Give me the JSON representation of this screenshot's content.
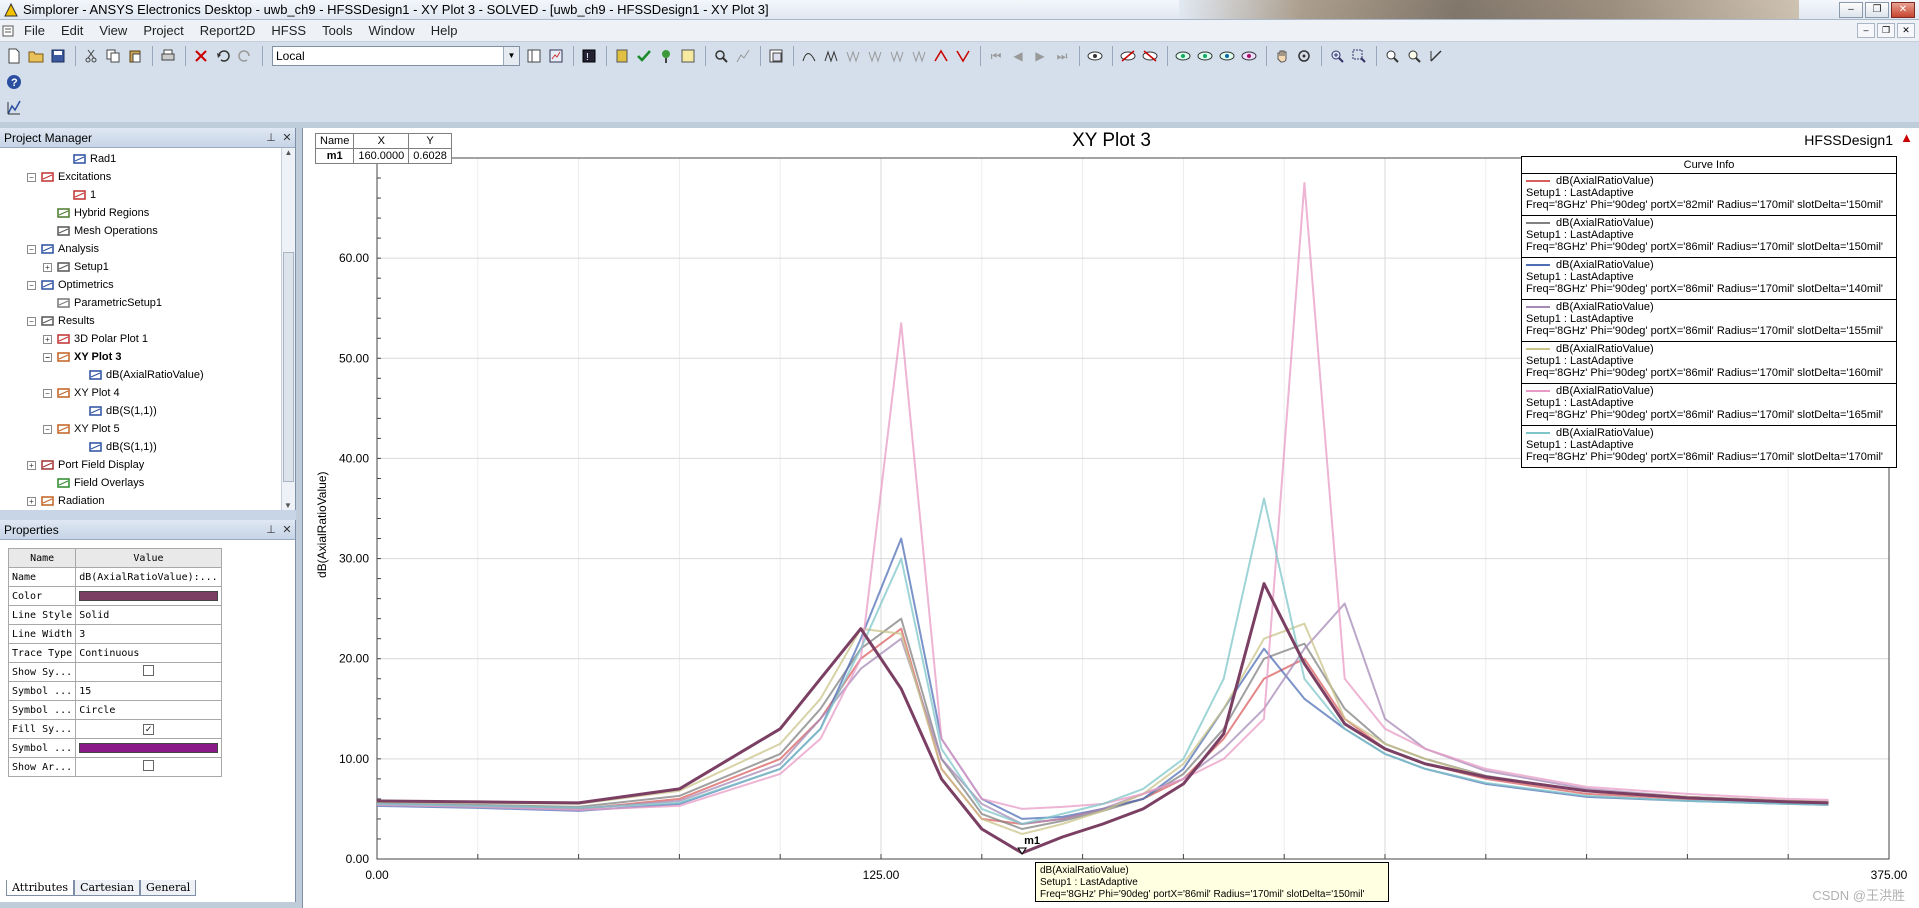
{
  "window": {
    "title": "Simplorer - ANSYS Electronics Desktop - uwb_ch9 - HFSSDesign1 - XY Plot 3 - SOLVED - [uwb_ch9 - HFSSDesign1 - XY Plot 3]",
    "min": "–",
    "max": "❐",
    "close": "✕"
  },
  "menu": [
    "File",
    "Edit",
    "View",
    "Project",
    "Report2D",
    "HFSS",
    "Tools",
    "Window",
    "Help"
  ],
  "toolbar": {
    "combo_value": "Local"
  },
  "project_manager": {
    "title": "Project Manager",
    "pin": "📌",
    "close": "✕",
    "items": [
      {
        "label": "Rad1",
        "indent": 4
      },
      {
        "label": "Excitations",
        "indent": 2,
        "exp": "−"
      },
      {
        "label": "1",
        "indent": 4
      },
      {
        "label": "Hybrid Regions",
        "indent": 3
      },
      {
        "label": "Mesh Operations",
        "indent": 3
      },
      {
        "label": "Analysis",
        "indent": 2,
        "exp": "−"
      },
      {
        "label": "Setup1",
        "indent": 3,
        "exp": "+"
      },
      {
        "label": "Optimetrics",
        "indent": 2,
        "exp": "−"
      },
      {
        "label": "ParametricSetup1",
        "indent": 3
      },
      {
        "label": "Results",
        "indent": 2,
        "exp": "−"
      },
      {
        "label": "3D Polar Plot 1",
        "indent": 3,
        "exp": "+"
      },
      {
        "label": "XY Plot 3",
        "indent": 3,
        "exp": "−",
        "bold": true
      },
      {
        "label": "dB(AxialRatioValue)",
        "indent": 5
      },
      {
        "label": "XY Plot 4",
        "indent": 3,
        "exp": "−"
      },
      {
        "label": "dB(S(1,1))",
        "indent": 5
      },
      {
        "label": "XY Plot 5",
        "indent": 3,
        "exp": "−"
      },
      {
        "label": "dB(S(1,1))",
        "indent": 5
      },
      {
        "label": "Port Field Display",
        "indent": 2,
        "exp": "+"
      },
      {
        "label": "Field Overlays",
        "indent": 3
      },
      {
        "label": "Radiation",
        "indent": 2,
        "exp": "+"
      }
    ]
  },
  "properties": {
    "title": "Properties",
    "pin": "📌",
    "close": "✕",
    "headers": [
      "Name",
      "Value"
    ],
    "rows": [
      {
        "name": "Name",
        "value": "dB(AxialRatioValue):..."
      },
      {
        "name": "Color",
        "value": "",
        "swatch": "#7a3f63"
      },
      {
        "name": "Line Style",
        "value": "Solid"
      },
      {
        "name": "Line Width",
        "value": "3"
      },
      {
        "name": "Trace Type",
        "value": "Continuous"
      },
      {
        "name": "Show Sy...",
        "value": "",
        "check": "☐"
      },
      {
        "name": "Symbol ...",
        "value": "15"
      },
      {
        "name": "Symbol ...",
        "value": "Circle"
      },
      {
        "name": "Fill Sy...",
        "value": "",
        "check": "☑"
      },
      {
        "name": "Symbol ...",
        "value": "",
        "swatch": "#8b1a89"
      },
      {
        "name": "Show Ar...",
        "value": "",
        "check": "☐"
      }
    ],
    "tabs": [
      "Attributes",
      "Cartesian",
      "General"
    ]
  },
  "plot": {
    "title": "XY Plot 3",
    "design": "HFSSDesign1",
    "flag": "▲",
    "marker_table": {
      "headers": [
        "Name",
        "X",
        "Y"
      ],
      "row": [
        "m1",
        "160.0000",
        "0.6028"
      ]
    },
    "curve_info_title": "Curve Info",
    "marker_label": "m1",
    "tooltip": [
      "dB(AxialRatioValue)",
      "Setup1 : LastAdaptive",
      "Freq='8GHz' Phi='90deg' portX='86mil' Radius='170mil' slotDelta='150mil'"
    ],
    "watermark": "CSDN @王洪胜"
  },
  "chart_data": {
    "type": "line",
    "title": "XY Plot 3",
    "xlabel": "",
    "ylabel": "dB(AxialRatioValue)",
    "xlim": [
      0,
      375
    ],
    "ylim": [
      0,
      70
    ],
    "x_ticks": [
      0,
      125,
      250,
      375
    ],
    "x_tick_labels": [
      "0.00",
      "125.00",
      "",
      "375.00"
    ],
    "y_ticks": [
      0,
      10,
      20,
      30,
      40,
      50,
      60
    ],
    "y_tick_labels": [
      "0.00",
      "10.00",
      "20.00",
      "30.00",
      "40.00",
      "50.00",
      "60.00"
    ],
    "grid": true,
    "legend": "top-right",
    "x": [
      0,
      25,
      50,
      75,
      100,
      110,
      120,
      130,
      140,
      150,
      160,
      170,
      180,
      190,
      200,
      210,
      220,
      230,
      240,
      250,
      260,
      275,
      300,
      325,
      350,
      360
    ],
    "series": [
      {
        "label": "dB(AxialRatioValue)",
        "setup": "Setup1 : LastAdaptive",
        "params": "Freq='8GHz' Phi='90deg' portX='82mil' Radius='170mil' slotDelta='150mil'",
        "color": "#d95f5f",
        "values": [
          5.5,
          5.3,
          5.0,
          6.0,
          10.0,
          14.0,
          20.0,
          23.0,
          9.0,
          4.0,
          3.5,
          4.0,
          5.0,
          6.0,
          8.0,
          12.0,
          18.0,
          20.0,
          14.0,
          11.0,
          9.5,
          8.0,
          6.5,
          6.0,
          5.7,
          5.6
        ]
      },
      {
        "label": "dB(AxialRatioValue)",
        "setup": "Setup1 : LastAdaptive",
        "params": "Freq='8GHz' Phi='90deg' portX='86mil' Radius='170mil' slotDelta='150mil'",
        "color": "#808080",
        "values": [
          5.6,
          5.4,
          5.2,
          6.3,
          10.5,
          15.0,
          21.0,
          24.0,
          10.0,
          4.5,
          3.0,
          3.8,
          4.8,
          6.0,
          8.5,
          13.0,
          20.0,
          21.5,
          15.0,
          11.5,
          10.0,
          8.3,
          6.8,
          6.2,
          5.8,
          5.7
        ]
      },
      {
        "label": "dB(AxialRatioValue)",
        "setup": "Setup1 : LastAdaptive",
        "params": "Freq='8GHz' Phi='90deg' portX='86mil' Radius='170mil' slotDelta='140mil'",
        "color": "#4f6fb5",
        "values": [
          5.3,
          5.1,
          4.8,
          5.5,
          9.0,
          13.0,
          22.0,
          32.0,
          12.0,
          6.0,
          4.0,
          4.2,
          5.0,
          6.0,
          9.0,
          15.0,
          21.0,
          16.0,
          13.0,
          10.5,
          9.0,
          7.5,
          6.2,
          5.8,
          5.5,
          5.4
        ]
      },
      {
        "label": "dB(AxialRatioValue)",
        "setup": "Setup1 : LastAdaptive",
        "params": "Freq='8GHz' Phi='90deg' portX='86mil' Radius='170mil' slotDelta='155mil'",
        "color": "#a58ab5",
        "values": [
          5.5,
          5.3,
          5.0,
          5.8,
          9.5,
          14.0,
          19.0,
          22.0,
          10.0,
          5.5,
          3.5,
          4.0,
          5.0,
          6.5,
          8.0,
          11.0,
          15.0,
          21.0,
          25.5,
          14.0,
          11.0,
          8.8,
          7.0,
          6.2,
          5.8,
          5.7
        ]
      },
      {
        "label": "dB(AxialRatioValue)",
        "setup": "Setup1 : LastAdaptive",
        "params": "Freq='8GHz' Phi='90deg' portX='86mil' Radius='170mil' slotDelta='160mil'",
        "color": "#c9c48a",
        "values": [
          5.7,
          5.6,
          5.5,
          6.8,
          11.5,
          16.0,
          23.0,
          22.5,
          9.0,
          4.0,
          2.5,
          3.5,
          4.8,
          6.5,
          9.5,
          15.0,
          22.0,
          23.5,
          14.0,
          11.5,
          10.0,
          8.2,
          6.8,
          6.2,
          5.8,
          5.7
        ]
      },
      {
        "label": "dB(AxialRatioValue)",
        "setup": "Setup1 : LastAdaptive",
        "params": "Freq='8GHz' Phi='90deg' portX='86mil' Radius='170mil' slotDelta='165mil'",
        "color": "#e89bc6",
        "values": [
          5.4,
          5.2,
          4.9,
          5.3,
          8.5,
          12.0,
          20.0,
          53.5,
          12.0,
          6.0,
          5.0,
          5.2,
          5.5,
          6.5,
          8.0,
          10.0,
          14.0,
          67.5,
          18.0,
          13.0,
          11.0,
          9.0,
          7.2,
          6.5,
          6.0,
          5.9
        ]
      },
      {
        "label": "dB(AxialRatioValue)",
        "setup": "Setup1 : LastAdaptive",
        "params": "Freq='8GHz' Phi='90deg' portX='86mil' Radius='170mil' slotDelta='170mil'",
        "color": "#7fc6c9",
        "values": [
          5.5,
          5.3,
          5.1,
          5.6,
          9.0,
          13.0,
          21.0,
          30.0,
          11.0,
          5.0,
          3.5,
          4.5,
          5.5,
          7.0,
          10.0,
          18.0,
          36.0,
          18.0,
          13.0,
          10.5,
          9.0,
          7.6,
          6.3,
          5.8,
          5.5,
          5.4
        ]
      },
      {
        "label": "dB(AxialRatioValue)",
        "params": "Freq='8GHz' Phi='90deg' portX='86mil' Radius='170mil' slotDelta='150mil'",
        "color": "#7a3f63",
        "width": 3,
        "values": [
          5.8,
          5.7,
          5.6,
          7.0,
          13.0,
          18.0,
          23.0,
          17.0,
          8.0,
          3.0,
          0.6,
          2.2,
          3.5,
          5.0,
          7.5,
          12.5,
          27.5,
          19.5,
          13.5,
          11.0,
          9.5,
          8.2,
          6.8,
          6.1,
          5.7,
          5.6
        ]
      }
    ]
  }
}
